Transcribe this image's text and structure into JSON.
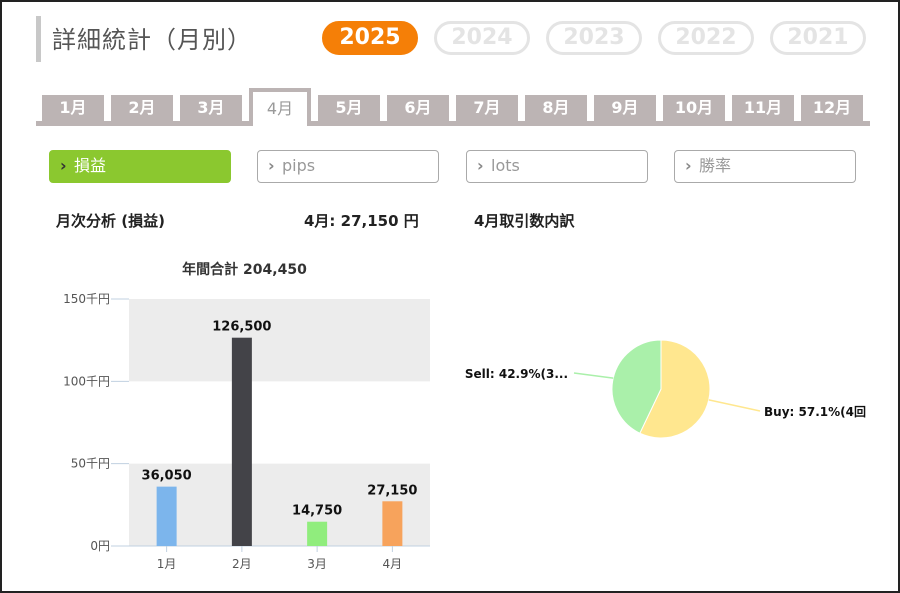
{
  "page_title": "詳細統計（月別）",
  "years": [
    {
      "label": "2025",
      "active": true
    },
    {
      "label": "2024",
      "active": false
    },
    {
      "label": "2023",
      "active": false
    },
    {
      "label": "2022",
      "active": false
    },
    {
      "label": "2021",
      "active": false
    }
  ],
  "months": [
    {
      "label": "1月",
      "active": false
    },
    {
      "label": "2月",
      "active": false
    },
    {
      "label": "3月",
      "active": false
    },
    {
      "label": "4月",
      "active": true
    },
    {
      "label": "5月",
      "active": false
    },
    {
      "label": "6月",
      "active": false
    },
    {
      "label": "7月",
      "active": false
    },
    {
      "label": "8月",
      "active": false
    },
    {
      "label": "9月",
      "active": false
    },
    {
      "label": "10月",
      "active": false
    },
    {
      "label": "11月",
      "active": false
    },
    {
      "label": "12月",
      "active": false
    }
  ],
  "metrics": [
    {
      "label": "損益",
      "active": true,
      "icon": "chevron-right-icon"
    },
    {
      "label": "pips",
      "active": false,
      "icon": "chevron-right-icon"
    },
    {
      "label": "lots",
      "active": false,
      "icon": "chevron-right-icon"
    },
    {
      "label": "勝率",
      "active": false,
      "icon": "chevron-right-icon"
    }
  ],
  "summary": {
    "analysis_label": "月次分析 (損益)",
    "month_value": "4月:  27,150 円",
    "breakdown_label": "4月取引数内訳"
  },
  "colors": {
    "accent_year": "#f57f07",
    "metric_active": "#8bc82f",
    "tab_gray": "#bcb4b4"
  },
  "chart_data": [
    {
      "type": "bar",
      "title": "年間合計 204,450",
      "categories": [
        "1月",
        "2月",
        "3月",
        "4月"
      ],
      "values": [
        36050,
        126500,
        14750,
        27150
      ],
      "value_labels": [
        "36,050",
        "126,500",
        "14,750",
        "27,150"
      ],
      "colors": [
        "#7cb5ec",
        "#434348",
        "#90ed7d",
        "#f7a35c"
      ],
      "ylim": [
        0,
        150000
      ],
      "yticks": [
        0,
        50000,
        100000,
        150000
      ],
      "ytick_labels": [
        "0円",
        "50千円",
        "100千円",
        "150千円"
      ],
      "alternate_bands": true
    },
    {
      "type": "pie",
      "slices": [
        {
          "label": "Buy: 57.1%(4回",
          "value": 57.1,
          "color": "#ffe78f"
        },
        {
          "label": "Sell: 42.9%(3...",
          "value": 42.9,
          "color": "#aaf0aa"
        }
      ]
    }
  ]
}
